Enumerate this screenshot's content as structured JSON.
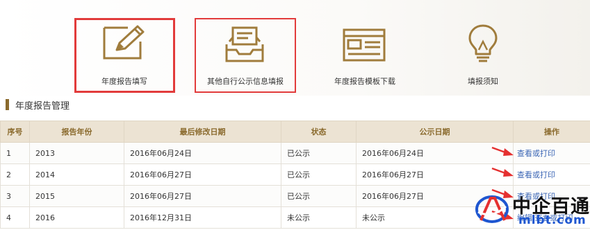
{
  "tiles": [
    {
      "icon": "edit-icon",
      "label": "年度报告填写"
    },
    {
      "icon": "inbox-tray-icon",
      "label": "其他自行公示信息填报"
    },
    {
      "icon": "template-layout-icon",
      "label": "年度报告模板下载"
    },
    {
      "icon": "lightbulb-icon",
      "label": "填报须知"
    }
  ],
  "section": {
    "title": "年度报告管理"
  },
  "table": {
    "headers": [
      "序号",
      "报告年份",
      "最后修改日期",
      "状态",
      "公示日期",
      "操作"
    ],
    "rows": [
      {
        "no": "1",
        "year": "2013",
        "modified": "2016年06月24日",
        "status": "已公示",
        "publish": "2016年06月24日",
        "action": "查看或打印"
      },
      {
        "no": "2",
        "year": "2014",
        "modified": "2016年06月27日",
        "status": "已公示",
        "publish": "2016年06月27日",
        "action": "查看或打印"
      },
      {
        "no": "3",
        "year": "2015",
        "modified": "2016年06月27日",
        "status": "已公示",
        "publish": "2016年06月27日",
        "action": "查看或打印"
      },
      {
        "no": "4",
        "year": "2016",
        "modified": "2016年12月31日",
        "status": "未公示",
        "publish": "未公示",
        "action": "编辑 查看或打印"
      }
    ]
  },
  "watermark": {
    "name": "中企百通",
    "url": "mlbt.com"
  },
  "colors": {
    "gold": "#8a6a2d",
    "header_bg": "#ece3d3",
    "highlight": "#e23b3b",
    "link": "#3b66b5"
  }
}
